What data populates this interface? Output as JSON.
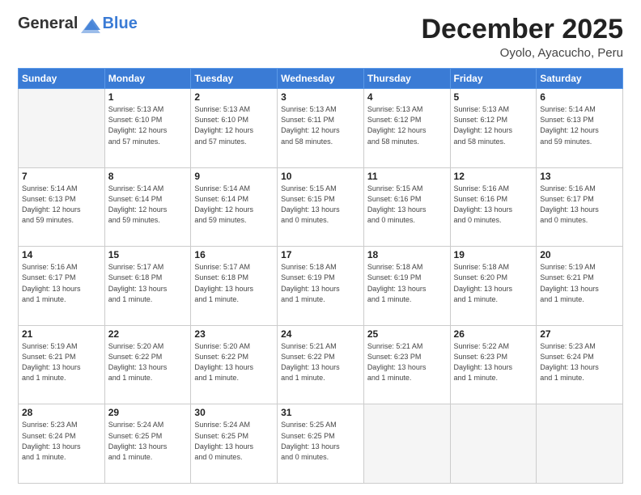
{
  "header": {
    "logo_general": "General",
    "logo_blue": "Blue",
    "month_title": "December 2025",
    "location": "Oyolo, Ayacucho, Peru"
  },
  "days_of_week": [
    "Sunday",
    "Monday",
    "Tuesday",
    "Wednesday",
    "Thursday",
    "Friday",
    "Saturday"
  ],
  "weeks": [
    [
      {
        "day": "",
        "info": ""
      },
      {
        "day": "1",
        "info": "Sunrise: 5:13 AM\nSunset: 6:10 PM\nDaylight: 12 hours\nand 57 minutes."
      },
      {
        "day": "2",
        "info": "Sunrise: 5:13 AM\nSunset: 6:10 PM\nDaylight: 12 hours\nand 57 minutes."
      },
      {
        "day": "3",
        "info": "Sunrise: 5:13 AM\nSunset: 6:11 PM\nDaylight: 12 hours\nand 58 minutes."
      },
      {
        "day": "4",
        "info": "Sunrise: 5:13 AM\nSunset: 6:12 PM\nDaylight: 12 hours\nand 58 minutes."
      },
      {
        "day": "5",
        "info": "Sunrise: 5:13 AM\nSunset: 6:12 PM\nDaylight: 12 hours\nand 58 minutes."
      },
      {
        "day": "6",
        "info": "Sunrise: 5:14 AM\nSunset: 6:13 PM\nDaylight: 12 hours\nand 59 minutes."
      }
    ],
    [
      {
        "day": "7",
        "info": "Sunrise: 5:14 AM\nSunset: 6:13 PM\nDaylight: 12 hours\nand 59 minutes."
      },
      {
        "day": "8",
        "info": "Sunrise: 5:14 AM\nSunset: 6:14 PM\nDaylight: 12 hours\nand 59 minutes."
      },
      {
        "day": "9",
        "info": "Sunrise: 5:14 AM\nSunset: 6:14 PM\nDaylight: 12 hours\nand 59 minutes."
      },
      {
        "day": "10",
        "info": "Sunrise: 5:15 AM\nSunset: 6:15 PM\nDaylight: 13 hours\nand 0 minutes."
      },
      {
        "day": "11",
        "info": "Sunrise: 5:15 AM\nSunset: 6:16 PM\nDaylight: 13 hours\nand 0 minutes."
      },
      {
        "day": "12",
        "info": "Sunrise: 5:16 AM\nSunset: 6:16 PM\nDaylight: 13 hours\nand 0 minutes."
      },
      {
        "day": "13",
        "info": "Sunrise: 5:16 AM\nSunset: 6:17 PM\nDaylight: 13 hours\nand 0 minutes."
      }
    ],
    [
      {
        "day": "14",
        "info": "Sunrise: 5:16 AM\nSunset: 6:17 PM\nDaylight: 13 hours\nand 1 minute."
      },
      {
        "day": "15",
        "info": "Sunrise: 5:17 AM\nSunset: 6:18 PM\nDaylight: 13 hours\nand 1 minute."
      },
      {
        "day": "16",
        "info": "Sunrise: 5:17 AM\nSunset: 6:18 PM\nDaylight: 13 hours\nand 1 minute."
      },
      {
        "day": "17",
        "info": "Sunrise: 5:18 AM\nSunset: 6:19 PM\nDaylight: 13 hours\nand 1 minute."
      },
      {
        "day": "18",
        "info": "Sunrise: 5:18 AM\nSunset: 6:19 PM\nDaylight: 13 hours\nand 1 minute."
      },
      {
        "day": "19",
        "info": "Sunrise: 5:18 AM\nSunset: 6:20 PM\nDaylight: 13 hours\nand 1 minute."
      },
      {
        "day": "20",
        "info": "Sunrise: 5:19 AM\nSunset: 6:21 PM\nDaylight: 13 hours\nand 1 minute."
      }
    ],
    [
      {
        "day": "21",
        "info": "Sunrise: 5:19 AM\nSunset: 6:21 PM\nDaylight: 13 hours\nand 1 minute."
      },
      {
        "day": "22",
        "info": "Sunrise: 5:20 AM\nSunset: 6:22 PM\nDaylight: 13 hours\nand 1 minute."
      },
      {
        "day": "23",
        "info": "Sunrise: 5:20 AM\nSunset: 6:22 PM\nDaylight: 13 hours\nand 1 minute."
      },
      {
        "day": "24",
        "info": "Sunrise: 5:21 AM\nSunset: 6:22 PM\nDaylight: 13 hours\nand 1 minute."
      },
      {
        "day": "25",
        "info": "Sunrise: 5:21 AM\nSunset: 6:23 PM\nDaylight: 13 hours\nand 1 minute."
      },
      {
        "day": "26",
        "info": "Sunrise: 5:22 AM\nSunset: 6:23 PM\nDaylight: 13 hours\nand 1 minute."
      },
      {
        "day": "27",
        "info": "Sunrise: 5:23 AM\nSunset: 6:24 PM\nDaylight: 13 hours\nand 1 minute."
      }
    ],
    [
      {
        "day": "28",
        "info": "Sunrise: 5:23 AM\nSunset: 6:24 PM\nDaylight: 13 hours\nand 1 minute."
      },
      {
        "day": "29",
        "info": "Sunrise: 5:24 AM\nSunset: 6:25 PM\nDaylight: 13 hours\nand 1 minute."
      },
      {
        "day": "30",
        "info": "Sunrise: 5:24 AM\nSunset: 6:25 PM\nDaylight: 13 hours\nand 0 minutes."
      },
      {
        "day": "31",
        "info": "Sunrise: 5:25 AM\nSunset: 6:25 PM\nDaylight: 13 hours\nand 0 minutes."
      },
      {
        "day": "",
        "info": ""
      },
      {
        "day": "",
        "info": ""
      },
      {
        "day": "",
        "info": ""
      }
    ]
  ]
}
